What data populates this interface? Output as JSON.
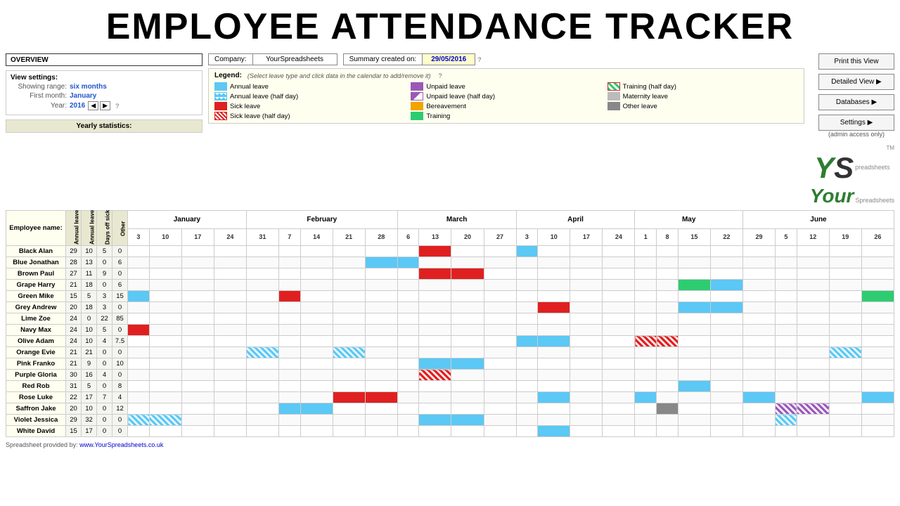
{
  "header": {
    "title": "EMPLOYEE ATTENDANCE TRACKER"
  },
  "overview": {
    "title": "OVERVIEW",
    "view_settings_label": "View settings:",
    "showing_range_label": "Showing range:",
    "showing_range_value": "six months",
    "first_month_label": "First month:",
    "first_month_value": "January",
    "year_label": "Year:",
    "year_value": "2016"
  },
  "company": {
    "label": "Company:",
    "value": "YourSpreadsheets",
    "summary_label": "Summary created on:",
    "summary_date": "29/05/2016"
  },
  "legend": {
    "title": "Legend:",
    "hint": "(Select leave type and click data in the calendar to add/remove it)",
    "items": [
      {
        "label": "Annual leave",
        "type": "annual"
      },
      {
        "label": "Unpaid leave",
        "type": "unpaid"
      },
      {
        "label": "Training (half day)",
        "type": "training-half"
      },
      {
        "label": "Annual leave (half day)",
        "type": "annual-half"
      },
      {
        "label": "Unpaid leave (half day)",
        "type": "unpaid-half"
      },
      {
        "label": "Maternity leave",
        "type": "maternity"
      },
      {
        "label": "Sick leave",
        "type": "sick"
      },
      {
        "label": "Bereavement",
        "type": "bereavement"
      },
      {
        "label": "Other leave",
        "type": "other"
      },
      {
        "label": "Sick leave (half day)",
        "type": "sick-half"
      },
      {
        "label": "Training",
        "type": "training"
      }
    ]
  },
  "buttons": {
    "print": "Print this View",
    "detailed": "Detailed View ▶",
    "databases": "Databases ▶",
    "settings": "Settings ▶",
    "settings_sub": "(admin access only)"
  },
  "yearly_stats": {
    "title": "Yearly statistics:",
    "columns": [
      "Annual leave allowance",
      "Annual leave taken",
      "Days off sick",
      "Other"
    ]
  },
  "calendar": {
    "months": [
      {
        "name": "January",
        "days": [
          "3",
          "10",
          "17",
          "24"
        ]
      },
      {
        "name": "February",
        "days": [
          "31",
          "7",
          "14",
          "21",
          "28"
        ]
      },
      {
        "name": "March",
        "days": [
          "6",
          "13",
          "20",
          "27"
        ]
      },
      {
        "name": "April",
        "days": [
          "3",
          "10",
          "17",
          "24"
        ]
      },
      {
        "name": "May",
        "days": [
          "1",
          "8",
          "15",
          "22"
        ]
      },
      {
        "name": "June",
        "days": [
          "29",
          "5",
          "12",
          "19",
          "26"
        ]
      }
    ],
    "employees": [
      {
        "name": "Black Alan",
        "allowance": 29,
        "taken": 10,
        "sick": 5,
        "other": 0,
        "leaves": {
          "march-13": "sick",
          "april-10": "annual"
        }
      },
      {
        "name": "Blue Jonathan",
        "allowance": 28,
        "taken": 13,
        "sick": 0,
        "other": 6,
        "leaves": {
          "feb-28": "annual",
          "march-6": "annual"
        }
      },
      {
        "name": "Brown Paul",
        "allowance": 27,
        "taken": 11,
        "sick": 9,
        "other": 0,
        "leaves": {
          "march-13": "sick",
          "march-20": "sick"
        }
      },
      {
        "name": "Grape Harry",
        "allowance": 21,
        "taken": 18,
        "sick": 0,
        "other": 6,
        "leaves": {}
      },
      {
        "name": "Green Mike",
        "allowance": 15,
        "taken": 5,
        "sick": 3,
        "other": 15,
        "leaves": {
          "jan-3": "annual",
          "feb-14": "sick",
          "june-26": "training"
        }
      },
      {
        "name": "Grey Andrew",
        "allowance": 20,
        "taken": 18,
        "sick": 3,
        "other": 0,
        "leaves": {
          "april-17": "sick"
        }
      },
      {
        "name": "Lime Zoe",
        "allowance": 24,
        "taken": 0,
        "sick": 22,
        "other": 85,
        "leaves": {}
      },
      {
        "name": "Navy Max",
        "allowance": 24,
        "taken": 10,
        "sick": 5,
        "other": 0,
        "leaves": {
          "jan-3": "sick"
        }
      },
      {
        "name": "Olive Adam",
        "allowance": 24,
        "taken": 10,
        "sick": 4,
        "other": 7.5,
        "leaves": {
          "may-1": "annual",
          "may-8": "annual",
          "may-8b": "sick-half"
        }
      },
      {
        "name": "Orange Evie",
        "allowance": 21,
        "taken": 21,
        "sick": 0,
        "other": 0,
        "leaves": {
          "feb-7": "annual-half",
          "feb-21": "annual-half",
          "june-19": "annual-half"
        }
      },
      {
        "name": "Pink Franko",
        "allowance": 21,
        "taken": 9,
        "sick": 0,
        "other": 10,
        "leaves": {
          "march-13": "annual",
          "march-20": "annual"
        }
      },
      {
        "name": "Purple Gloria",
        "allowance": 30,
        "taken": 16,
        "sick": 4,
        "other": 0,
        "leaves": {
          "march-13": "sick-half"
        }
      },
      {
        "name": "Red Rob",
        "allowance": 31,
        "taken": 5,
        "sick": 0,
        "other": 8,
        "leaves": {
          "may-15": "annual"
        }
      },
      {
        "name": "Rose Luke",
        "allowance": 22,
        "taken": 17,
        "sick": 7,
        "other": 4,
        "leaves": {
          "feb-21": "sick",
          "feb-28": "sick",
          "april-10": "annual",
          "may-29": "annual"
        }
      },
      {
        "name": "Saffron Jake",
        "allowance": 20,
        "taken": 10,
        "sick": 0,
        "other": 12,
        "leaves": {
          "feb-7": "annual",
          "feb-14": "annual",
          "may-8": "other"
        }
      },
      {
        "name": "Violet Jessica",
        "allowance": 29,
        "taken": 32,
        "sick": 0,
        "other": 0,
        "leaves": {
          "jan-3": "annual-half",
          "jan-10": "annual-half",
          "march-13": "annual",
          "march-20": "annual",
          "june-5": "annual-half"
        }
      },
      {
        "name": "White David",
        "allowance": 15,
        "taken": 17,
        "sick": 0,
        "other": 0,
        "leaves": {
          "april-10": "annual"
        }
      }
    ]
  },
  "footer": {
    "prefix": "Spreadsheet provided by:",
    "link_text": "www.YourSpreadsheets.co.uk",
    "link_url": "#"
  }
}
